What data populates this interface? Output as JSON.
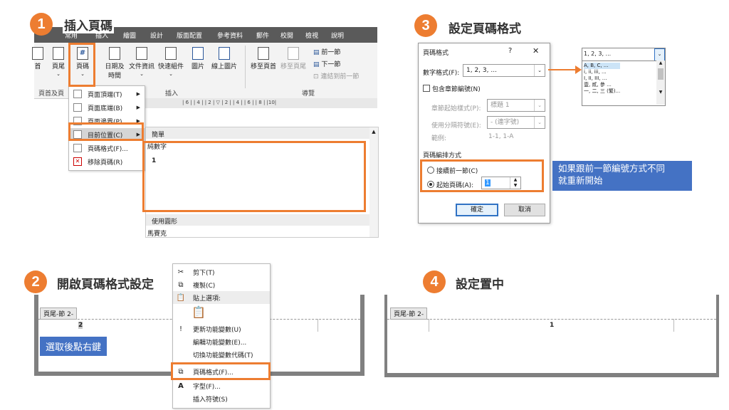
{
  "colors": {
    "accent": "#ED7D31",
    "note_blue": "#4472C4",
    "ribbon_bg": "#F3F3F3",
    "tab_bar_bg": "#5A5A5A"
  },
  "step1": {
    "number": "1",
    "title": "插入頁碼",
    "tabs": [
      "常用",
      "插入",
      "繪圖",
      "設計",
      "版面配置",
      "參考資料",
      "郵件",
      "校閱",
      "檢視",
      "說明"
    ],
    "ribbon": {
      "header": "頁首",
      "footer": "頁尾",
      "page_number": "頁碼",
      "date_time_1": "日期及",
      "date_time_2": "時間",
      "doc_info": "文件資訊",
      "quick_parts": "快速組件",
      "picture": "圖片",
      "online_picture": "線上圖片",
      "goto_header": "移至頁首",
      "goto_footer": "移至頁尾",
      "prev_section": "前一節",
      "next_section": "下一節",
      "link_prev": "連結到前一節",
      "group_header_footer": "頁首及頁",
      "group_insert": "插入",
      "group_nav": "導覽"
    },
    "ruler": "| 6 |  | 4 |  | 2 |   ▽  | 2 |  | 4 |  | 6 |  | 8 |  |10|",
    "menu": [
      "頁面頂端(T)",
      "頁面底端(B)",
      "頁面邊界(P)",
      "目前位置(C)",
      "頁碼格式(F)...",
      "移除頁碼(R)"
    ],
    "gallery": {
      "section": "簡單",
      "item": "純數字",
      "preview": "1",
      "section2": "使用圓形",
      "item2": "馬賽克"
    }
  },
  "step2": {
    "number": "2",
    "title": "開啟頁碼格式設定",
    "footer_tag": "頁尾-節 2-",
    "page_num": "2",
    "note": "選取後點右鍵",
    "menu": [
      "剪下(T)",
      "複製(C)",
      "貼上選項:",
      "更新功能變數(U)",
      "編輯功能變數(E)...",
      "切換功能變數代碼(T)",
      "頁碼格式(F)...",
      "字型(F)...",
      "插入符號(S)"
    ]
  },
  "step3": {
    "number": "3",
    "title": "設定頁碼格式",
    "dialog_title": "頁碼格式",
    "help": "?",
    "close": "✕",
    "number_format_label": "數字格式(F):",
    "number_format_value": "1, 2, 3, ...",
    "include_chapter": "包含章節編號(N)",
    "chapter_style_label": "章節起始樣式(P):",
    "chapter_style_value": "標題 1",
    "separator_label": "使用分隔符號(E):",
    "separator_value": "-  (連字號)",
    "example_label": "範例:",
    "example_value": "1-1, 1-A",
    "numbering_label": "頁碼編排方式",
    "continue": "接續前一節(C)",
    "start_at": "起始頁碼(A):",
    "start_value": "1",
    "ok": "確定",
    "cancel": "取消",
    "dropdown_value": "1, 2, 3, ...",
    "dropdown_options": [
      "A, B, C, ...",
      "i, ii, iii, ...",
      "I, II, III, ...",
      "壹, 貳, 參 ...",
      "一, 二, 三 (繁)..."
    ],
    "note_line1": "如果跟前一節編號方式不同",
    "note_line2": "就重新開始"
  },
  "step4": {
    "number": "4",
    "title": "設定置中",
    "footer_tag": "頁尾-節 2-",
    "page_num": "1"
  }
}
